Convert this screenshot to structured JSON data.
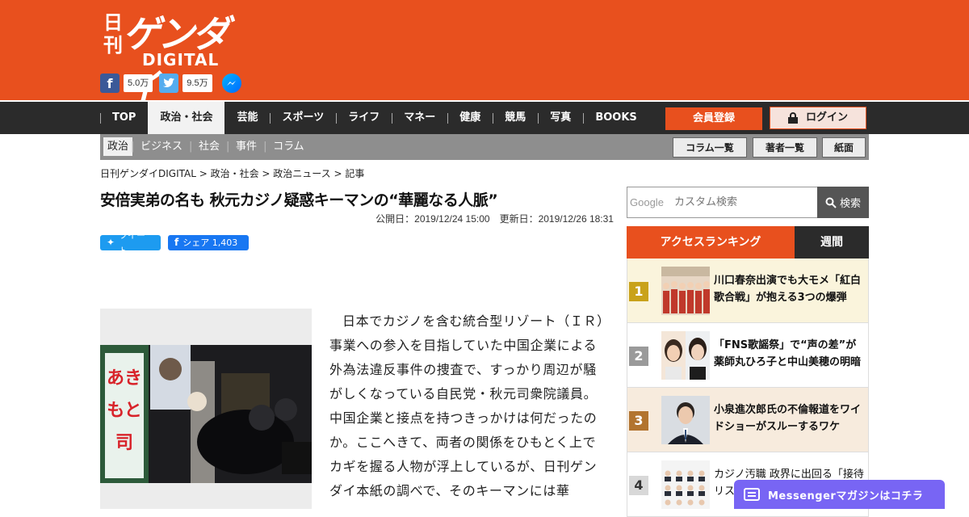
{
  "brand": {
    "nikkan": "日刊",
    "gendai": "ゲンダイ",
    "digital": "DIGITAL"
  },
  "social": {
    "facebook_count": "5.0万",
    "twitter_count": "9.5万"
  },
  "nav": {
    "items": [
      "TOP",
      "政治・社会",
      "芸能",
      "スポーツ",
      "ライフ",
      "マネー",
      "健康",
      "競馬",
      "写真",
      "BOOKS"
    ],
    "active": "政治・社会",
    "register": "会員登録",
    "login": "ログイン"
  },
  "subnav": {
    "items": [
      "政治",
      "ビジネス",
      "社会",
      "事件",
      "コラム"
    ],
    "buttons": [
      "コラム一覧",
      "著者一覧",
      "紙面"
    ]
  },
  "breadcrumb": "日刊ゲンダイDIGITAL > 政治・社会 > 政治ニュース > 記事",
  "article": {
    "title": "安倍実弟の名も 秋元カジノ疑惑キーマンの“華麗なる人脈”",
    "dates": "公開日：2019/12/24 15:00　更新日：2019/12/26 18:31",
    "tweet": "ツイート",
    "share": "シェア 1,403",
    "body": "日本でカジノを含む統合型リゾート（ＩＲ）事業への参入を目指していた中国企業による外為法違反事件の捜査で、すっかり周辺が騒がしくなっている自民党・秋元司衆院議員。中国企業と接点を持つきっかけは何だったのか。ここへきて、両者の関係をひもとく上でカギを握る人物が浮上しているが、日刊ゲンダイ本紙の調べで、そのキーマンには華"
  },
  "search": {
    "google_label": "Google",
    "placeholder": "カスタム検索",
    "button": "検索"
  },
  "ranking": {
    "tab_access": "アクセスランキング",
    "tab_weekly": "週間",
    "items": [
      {
        "rank": "1",
        "title": "川口春奈出演でも大モメ「紅白歌合戦」が抱える3つの爆弾"
      },
      {
        "rank": "2",
        "title": "「FNS歌謡祭」で“声の差”が 薬師丸ひろ子と中山美穂の明暗"
      },
      {
        "rank": "3",
        "title": "小泉進次郎氏の不倫報道をワイドショーがスルーするワケ"
      },
      {
        "rank": "4",
        "title": "カジノ汚職 政界に出回る「接待リスト"
      }
    ]
  },
  "messenger": {
    "label": "Messengerマガジンはコチラ"
  },
  "colors": {
    "brand": "#e8501e",
    "nav": "#2b2b2b",
    "rank1": "#c9a21a",
    "rank2": "#9a9a9a",
    "rank3": "#b2742f",
    "messenger": "#7865f4"
  }
}
